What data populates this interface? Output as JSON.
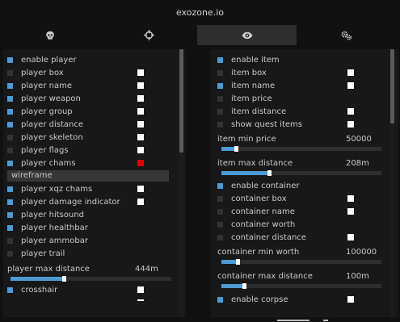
{
  "title": "exozone.io",
  "tabs": [
    {
      "icon": "skull-icon",
      "active": false
    },
    {
      "icon": "crosshair-icon",
      "active": false
    },
    {
      "icon": "eye-icon",
      "active": true
    },
    {
      "icon": "gears-icon",
      "active": false
    }
  ],
  "colors": {
    "accent": "#4d9ad4",
    "bg": "#111111",
    "panel": "#181818",
    "swatch_white": "#ffffff",
    "swatch_red": "#dd0000"
  },
  "left": {
    "items": [
      {
        "label": "enable player",
        "checked": true
      },
      {
        "label": "player box",
        "checked": false,
        "swatch": "#ffffff"
      },
      {
        "label": "player name",
        "checked": true,
        "swatch": "#ffffff"
      },
      {
        "label": "player weapon",
        "checked": true,
        "swatch": "#ffffff"
      },
      {
        "label": "player group",
        "checked": true,
        "swatch": "#ffffff"
      },
      {
        "label": "player distance",
        "checked": true,
        "swatch": "#ffffff"
      },
      {
        "label": "player skeleton",
        "checked": false,
        "swatch": "#ffffff"
      },
      {
        "label": "player flags",
        "checked": false,
        "swatch": "#ffffff"
      },
      {
        "label": "player chams",
        "checked": true,
        "swatch": "#dd0000"
      }
    ],
    "wireframe_label": "wireframe",
    "items2": [
      {
        "label": "player xqz chams",
        "checked": true,
        "swatch": "#ffffff"
      },
      {
        "label": "player damage indicator",
        "checked": true,
        "swatch": "#ffffff"
      },
      {
        "label": "player hitsound",
        "checked": true
      },
      {
        "label": "player healthbar",
        "checked": true
      },
      {
        "label": "player ammobar",
        "checked": false
      },
      {
        "label": "player trail",
        "checked": false
      }
    ],
    "slider": {
      "label": "player max distance",
      "value": "444m",
      "fraction": 0.33
    },
    "crosshair": {
      "label": "crosshair",
      "checked": true,
      "swatch": "#ffffff"
    }
  },
  "right": {
    "items": [
      {
        "label": "enable item",
        "checked": true
      },
      {
        "label": "item box",
        "checked": false,
        "swatch": "#ffffff"
      },
      {
        "label": "item name",
        "checked": true,
        "swatch": "#ffffff"
      },
      {
        "label": "item price",
        "checked": false
      },
      {
        "label": "item distance",
        "checked": false,
        "swatch": "#ffffff"
      },
      {
        "label": "show quest items",
        "checked": false,
        "swatch": "#ffffff"
      }
    ],
    "slider1": {
      "label": "item min price",
      "value": "50000",
      "fraction": 0.09
    },
    "slider2": {
      "label": "item max distance",
      "value": "208m",
      "fraction": 0.3
    },
    "items2": [
      {
        "label": "enable container",
        "checked": true
      },
      {
        "label": "container box",
        "checked": false,
        "swatch": "#ffffff"
      },
      {
        "label": "container name",
        "checked": false,
        "swatch": "#ffffff"
      },
      {
        "label": "container worth",
        "checked": false
      },
      {
        "label": "container distance",
        "checked": false,
        "swatch": "#ffffff"
      }
    ],
    "slider3": {
      "label": "container min worth",
      "value": "100000",
      "fraction": 0.1
    },
    "slider4": {
      "label": "container max distance",
      "value": "100m",
      "fraction": 0.14
    },
    "corpse": {
      "label": "enable corpse",
      "checked": true,
      "swatch": "#ffffff"
    }
  }
}
